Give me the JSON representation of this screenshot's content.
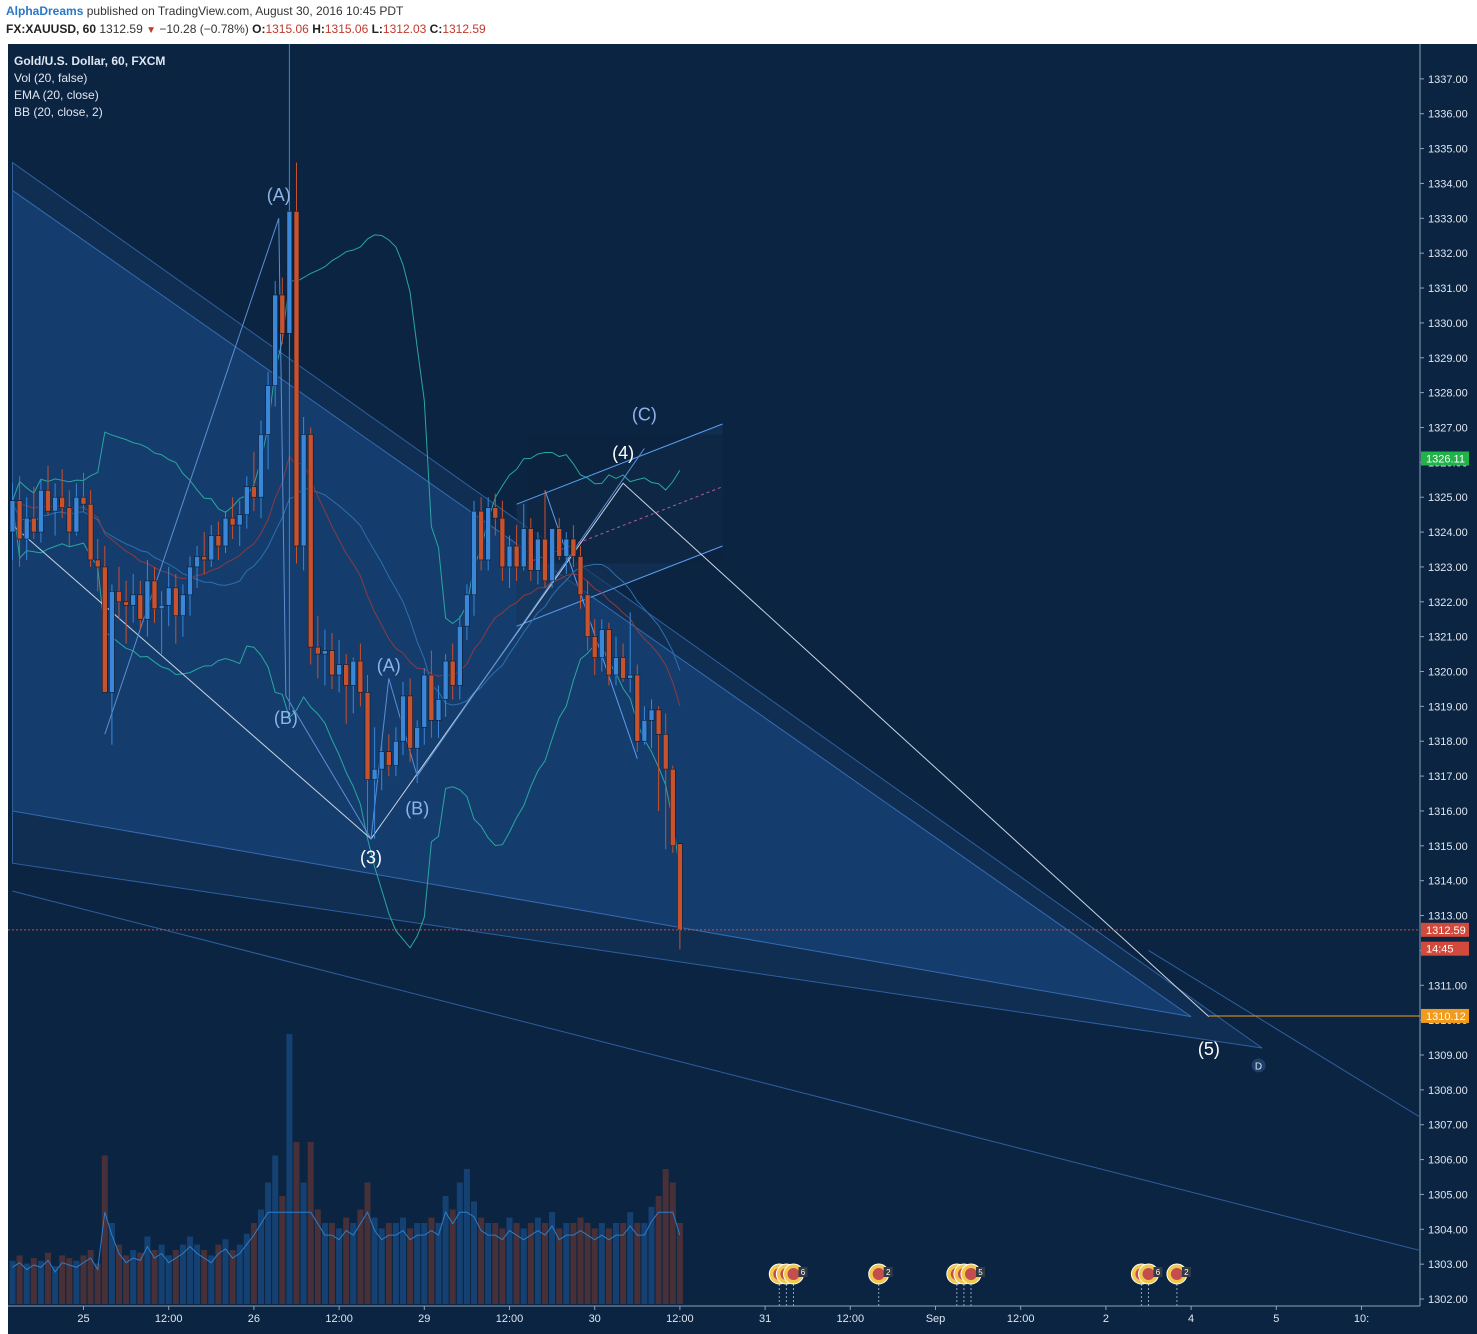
{
  "header": {
    "author": "AlphaDreams",
    "published": "published on TradingView.com, August 30, 2016 10:45 PDT",
    "symbol": "FX:XAUUSD, 60",
    "last": "1312.59",
    "change": "−10.28 (−0.78%)",
    "o_label": "O:",
    "o": "1315.06",
    "h_label": "H:",
    "h": "1315.06",
    "l_label": "L:",
    "l": "1312.03",
    "c_label": "C:",
    "c": "1312.59"
  },
  "legend": {
    "title": "Gold/U.S. Dollar, 60, FXCM",
    "vol": "Vol (20, false)",
    "ema": "EMA (20, close)",
    "bb": "BB (20, close, 2)"
  },
  "colors": {
    "background": "#0b2442",
    "up": "#3a86d8",
    "down": "#c8512e",
    "bb": "#2aa6a0",
    "ema": "#8a3a40",
    "price_tag": "#d24a3b",
    "countdown_tag": "#d24a3b",
    "target_tag": "#f09a1e",
    "high_tag": "#22b24a"
  },
  "chart_data": {
    "type": "candlestick",
    "symbol": "FX:XAUUSD",
    "interval": "60",
    "y_range": [
      1301.8,
      1338.0
    ],
    "y_ticks": [
      1302,
      1303,
      1304,
      1305,
      1306,
      1307,
      1308,
      1309,
      1310,
      1311,
      1312,
      1313,
      1314,
      1315,
      1316,
      1317,
      1318,
      1319,
      1320,
      1321,
      1322,
      1323,
      1324,
      1325,
      1326,
      1327,
      1328,
      1329,
      1330,
      1331,
      1332,
      1333,
      1334,
      1335,
      1336,
      1337
    ],
    "x_labels": [
      {
        "label": "25",
        "bar": 10
      },
      {
        "label": "12:00",
        "bar": 22
      },
      {
        "label": "26",
        "bar": 34
      },
      {
        "label": "12:00",
        "bar": 46
      },
      {
        "label": "29",
        "bar": 58
      },
      {
        "label": "12:00",
        "bar": 70
      },
      {
        "label": "30",
        "bar": 82
      },
      {
        "label": "12:00",
        "bar": 94
      },
      {
        "label": "31",
        "bar": 106
      },
      {
        "label": "12:00",
        "bar": 118
      },
      {
        "label": "Sep",
        "bar": 130
      },
      {
        "label": "12:00",
        "bar": 142
      },
      {
        "label": "2",
        "bar": 154
      },
      {
        "label": "4",
        "bar": 166
      },
      {
        "label": "5",
        "bar": 178
      },
      {
        "label": "10:",
        "bar": 190
      }
    ],
    "candles": [
      {
        "o": 1324.0,
        "h": 1325.4,
        "l": 1323.2,
        "c": 1324.9
      },
      {
        "o": 1324.9,
        "h": 1325.6,
        "l": 1323.0,
        "c": 1323.8
      },
      {
        "o": 1323.8,
        "h": 1325.0,
        "l": 1323.2,
        "c": 1324.4
      },
      {
        "o": 1324.4,
        "h": 1325.3,
        "l": 1323.8,
        "c": 1324.0
      },
      {
        "o": 1324.0,
        "h": 1325.5,
        "l": 1323.7,
        "c": 1325.2
      },
      {
        "o": 1325.2,
        "h": 1325.9,
        "l": 1324.5,
        "c": 1324.6
      },
      {
        "o": 1324.6,
        "h": 1325.4,
        "l": 1323.9,
        "c": 1325.0
      },
      {
        "o": 1325.0,
        "h": 1325.8,
        "l": 1324.4,
        "c": 1324.7
      },
      {
        "o": 1324.7,
        "h": 1325.2,
        "l": 1323.6,
        "c": 1324.0
      },
      {
        "o": 1324.0,
        "h": 1325.4,
        "l": 1323.9,
        "c": 1325.0
      },
      {
        "o": 1325.0,
        "h": 1325.7,
        "l": 1324.6,
        "c": 1324.8
      },
      {
        "o": 1324.8,
        "h": 1325.2,
        "l": 1323.0,
        "c": 1323.2
      },
      {
        "o": 1323.2,
        "h": 1323.8,
        "l": 1322.3,
        "c": 1323.0
      },
      {
        "o": 1323.0,
        "h": 1323.6,
        "l": 1319.4,
        "c": 1319.4
      },
      {
        "o": 1319.4,
        "h": 1322.5,
        "l": 1317.9,
        "c": 1322.3
      },
      {
        "o": 1322.3,
        "h": 1323.0,
        "l": 1321.5,
        "c": 1322.0
      },
      {
        "o": 1322.0,
        "h": 1322.6,
        "l": 1320.8,
        "c": 1321.9
      },
      {
        "o": 1321.9,
        "h": 1322.8,
        "l": 1321.4,
        "c": 1322.2
      },
      {
        "o": 1322.2,
        "h": 1322.6,
        "l": 1321.2,
        "c": 1321.5
      },
      {
        "o": 1321.5,
        "h": 1323.2,
        "l": 1321.0,
        "c": 1322.6
      },
      {
        "o": 1322.6,
        "h": 1323.0,
        "l": 1321.4,
        "c": 1321.8
      },
      {
        "o": 1321.8,
        "h": 1322.3,
        "l": 1320.5,
        "c": 1321.9
      },
      {
        "o": 1321.9,
        "h": 1323.0,
        "l": 1321.3,
        "c": 1322.4
      },
      {
        "o": 1322.4,
        "h": 1322.8,
        "l": 1320.8,
        "c": 1321.6
      },
      {
        "o": 1321.6,
        "h": 1322.5,
        "l": 1321.0,
        "c": 1322.2
      },
      {
        "o": 1322.2,
        "h": 1323.3,
        "l": 1321.6,
        "c": 1323.0
      },
      {
        "o": 1323.0,
        "h": 1323.6,
        "l": 1322.4,
        "c": 1323.3
      },
      {
        "o": 1323.3,
        "h": 1324.0,
        "l": 1322.8,
        "c": 1323.2
      },
      {
        "o": 1323.2,
        "h": 1324.2,
        "l": 1323.0,
        "c": 1323.9
      },
      {
        "o": 1323.9,
        "h": 1324.3,
        "l": 1323.2,
        "c": 1323.6
      },
      {
        "o": 1323.6,
        "h": 1324.6,
        "l": 1323.4,
        "c": 1324.4
      },
      {
        "o": 1324.4,
        "h": 1325.0,
        "l": 1323.8,
        "c": 1324.2
      },
      {
        "o": 1324.2,
        "h": 1324.9,
        "l": 1323.6,
        "c": 1324.5
      },
      {
        "o": 1324.5,
        "h": 1325.6,
        "l": 1324.1,
        "c": 1325.3
      },
      {
        "o": 1325.3,
        "h": 1326.3,
        "l": 1324.6,
        "c": 1325.0
      },
      {
        "o": 1325.0,
        "h": 1327.2,
        "l": 1324.4,
        "c": 1326.8
      },
      {
        "o": 1326.8,
        "h": 1328.6,
        "l": 1325.8,
        "c": 1328.2
      },
      {
        "o": 1328.2,
        "h": 1331.2,
        "l": 1327.6,
        "c": 1330.8
      },
      {
        "o": 1330.8,
        "h": 1331.3,
        "l": 1329.4,
        "c": 1329.7
      },
      {
        "o": 1329.7,
        "h": 1340.5,
        "l": 1318.9,
        "c": 1333.2
      },
      {
        "o": 1333.2,
        "h": 1334.6,
        "l": 1323.1,
        "c": 1323.6
      },
      {
        "o": 1323.6,
        "h": 1327.3,
        "l": 1322.9,
        "c": 1326.8
      },
      {
        "o": 1326.8,
        "h": 1327.0,
        "l": 1320.2,
        "c": 1320.7
      },
      {
        "o": 1320.7,
        "h": 1321.6,
        "l": 1319.8,
        "c": 1320.5
      },
      {
        "o": 1320.5,
        "h": 1321.2,
        "l": 1319.6,
        "c": 1320.6
      },
      {
        "o": 1320.6,
        "h": 1321.1,
        "l": 1319.5,
        "c": 1319.9
      },
      {
        "o": 1319.9,
        "h": 1320.9,
        "l": 1319.4,
        "c": 1320.2
      },
      {
        "o": 1320.2,
        "h": 1320.5,
        "l": 1318.5,
        "c": 1319.6
      },
      {
        "o": 1319.6,
        "h": 1320.4,
        "l": 1318.8,
        "c": 1320.3
      },
      {
        "o": 1320.3,
        "h": 1320.8,
        "l": 1319.0,
        "c": 1319.4
      },
      {
        "o": 1319.4,
        "h": 1319.9,
        "l": 1315.3,
        "c": 1316.9
      },
      {
        "o": 1316.9,
        "h": 1318.4,
        "l": 1315.2,
        "c": 1317.2
      },
      {
        "o": 1317.2,
        "h": 1318.0,
        "l": 1316.6,
        "c": 1317.7
      },
      {
        "o": 1317.7,
        "h": 1318.2,
        "l": 1317.0,
        "c": 1317.3
      },
      {
        "o": 1317.3,
        "h": 1318.4,
        "l": 1317.0,
        "c": 1318.0
      },
      {
        "o": 1318.0,
        "h": 1319.7,
        "l": 1317.6,
        "c": 1319.3
      },
      {
        "o": 1319.3,
        "h": 1319.8,
        "l": 1317.4,
        "c": 1317.8
      },
      {
        "o": 1317.8,
        "h": 1318.6,
        "l": 1316.8,
        "c": 1318.4
      },
      {
        "o": 1318.4,
        "h": 1320.1,
        "l": 1317.9,
        "c": 1319.9
      },
      {
        "o": 1319.9,
        "h": 1320.6,
        "l": 1318.1,
        "c": 1318.6
      },
      {
        "o": 1318.6,
        "h": 1319.6,
        "l": 1318.1,
        "c": 1319.2
      },
      {
        "o": 1319.2,
        "h": 1320.5,
        "l": 1318.7,
        "c": 1320.3
      },
      {
        "o": 1320.3,
        "h": 1320.8,
        "l": 1319.2,
        "c": 1319.6
      },
      {
        "o": 1319.6,
        "h": 1321.6,
        "l": 1319.2,
        "c": 1321.3
      },
      {
        "o": 1321.3,
        "h": 1322.5,
        "l": 1320.9,
        "c": 1322.2
      },
      {
        "o": 1322.2,
        "h": 1324.9,
        "l": 1321.6,
        "c": 1324.6
      },
      {
        "o": 1324.6,
        "h": 1325.0,
        "l": 1322.9,
        "c": 1323.2
      },
      {
        "o": 1323.2,
        "h": 1325.0,
        "l": 1322.9,
        "c": 1324.7
      },
      {
        "o": 1324.7,
        "h": 1325.1,
        "l": 1323.9,
        "c": 1324.4
      },
      {
        "o": 1324.4,
        "h": 1324.9,
        "l": 1322.6,
        "c": 1323.0
      },
      {
        "o": 1323.0,
        "h": 1323.9,
        "l": 1322.4,
        "c": 1323.6
      },
      {
        "o": 1323.6,
        "h": 1324.2,
        "l": 1322.6,
        "c": 1323.0
      },
      {
        "o": 1323.0,
        "h": 1324.8,
        "l": 1322.9,
        "c": 1324.1
      },
      {
        "o": 1324.1,
        "h": 1324.4,
        "l": 1322.6,
        "c": 1322.9
      },
      {
        "o": 1322.9,
        "h": 1324.0,
        "l": 1322.5,
        "c": 1323.8
      },
      {
        "o": 1323.8,
        "h": 1325.2,
        "l": 1322.4,
        "c": 1322.6
      },
      {
        "o": 1322.6,
        "h": 1324.1,
        "l": 1322.4,
        "c": 1324.1
      },
      {
        "o": 1324.1,
        "h": 1324.4,
        "l": 1323.2,
        "c": 1323.3
      },
      {
        "o": 1323.3,
        "h": 1324.0,
        "l": 1322.8,
        "c": 1323.8
      },
      {
        "o": 1323.8,
        "h": 1324.2,
        "l": 1323.0,
        "c": 1323.3
      },
      {
        "o": 1323.3,
        "h": 1323.6,
        "l": 1321.8,
        "c": 1322.2
      },
      {
        "o": 1322.2,
        "h": 1322.6,
        "l": 1320.6,
        "c": 1321.0
      },
      {
        "o": 1321.0,
        "h": 1321.5,
        "l": 1319.9,
        "c": 1320.4
      },
      {
        "o": 1320.4,
        "h": 1321.5,
        "l": 1320.0,
        "c": 1321.2
      },
      {
        "o": 1321.2,
        "h": 1321.4,
        "l": 1319.6,
        "c": 1319.9
      },
      {
        "o": 1319.9,
        "h": 1321.0,
        "l": 1319.6,
        "c": 1320.4
      },
      {
        "o": 1320.4,
        "h": 1320.8,
        "l": 1319.7,
        "c": 1319.8
      },
      {
        "o": 1319.8,
        "h": 1321.7,
        "l": 1319.4,
        "c": 1319.9
      },
      {
        "o": 1319.9,
        "h": 1320.2,
        "l": 1317.7,
        "c": 1318.0
      },
      {
        "o": 1318.0,
        "h": 1319.0,
        "l": 1317.9,
        "c": 1318.6
      },
      {
        "o": 1318.6,
        "h": 1319.2,
        "l": 1317.8,
        "c": 1318.9
      },
      {
        "o": 1318.9,
        "h": 1319.0,
        "l": 1316.0,
        "c": 1318.2
      },
      {
        "o": 1318.2,
        "h": 1318.8,
        "l": 1314.9,
        "c": 1317.2
      },
      {
        "o": 1317.2,
        "h": 1317.3,
        "l": 1314.8,
        "c": 1315.0
      },
      {
        "o": 1315.06,
        "h": 1315.06,
        "l": 1312.03,
        "c": 1312.59
      }
    ],
    "volume": [
      0.16,
      0.18,
      0.15,
      0.17,
      0.16,
      0.19,
      0.14,
      0.18,
      0.17,
      0.16,
      0.18,
      0.2,
      0.15,
      0.55,
      0.3,
      0.22,
      0.18,
      0.2,
      0.19,
      0.25,
      0.2,
      0.22,
      0.18,
      0.2,
      0.22,
      0.25,
      0.22,
      0.2,
      0.18,
      0.22,
      0.24,
      0.2,
      0.22,
      0.26,
      0.3,
      0.35,
      0.45,
      0.55,
      0.4,
      1.0,
      0.6,
      0.45,
      0.6,
      0.35,
      0.3,
      0.3,
      0.28,
      0.32,
      0.3,
      0.35,
      0.45,
      0.32,
      0.28,
      0.3,
      0.3,
      0.32,
      0.28,
      0.3,
      0.3,
      0.32,
      0.3,
      0.4,
      0.35,
      0.45,
      0.5,
      0.38,
      0.32,
      0.3,
      0.3,
      0.28,
      0.32,
      0.3,
      0.28,
      0.3,
      0.32,
      0.3,
      0.34,
      0.28,
      0.3,
      0.3,
      0.32,
      0.3,
      0.28,
      0.3,
      0.28,
      0.3,
      0.3,
      0.34,
      0.3,
      0.3,
      0.36,
      0.4,
      0.5,
      0.45,
      0.3
    ],
    "price_tags": [
      {
        "label": "1326.11",
        "value": 1326.11,
        "color": "#22b24a"
      },
      {
        "label": "1312.59",
        "value": 1312.59,
        "color": "#d24a3b"
      },
      {
        "label": "14:45",
        "value": 1312.05,
        "color": "#d24a3b"
      },
      {
        "label": "1310.12",
        "value": 1310.12,
        "color": "#f09a1e"
      }
    ],
    "wave_labels": [
      {
        "text": "(A)",
        "bar": 37.5,
        "price": 1333.5,
        "color": "#8fb4e8"
      },
      {
        "text": "(B)",
        "bar": 38.5,
        "price": 1318.5,
        "color": "#8fb4e8"
      },
      {
        "text": "(3)",
        "bar": 50.5,
        "price": 1314.5,
        "color": "#ffffff"
      },
      {
        "text": "(A)",
        "bar": 53,
        "price": 1320.0,
        "color": "#8fb4e8"
      },
      {
        "text": "(B)",
        "bar": 57,
        "price": 1315.9,
        "color": "#8fb4e8"
      },
      {
        "text": "(4)",
        "bar": 86,
        "price": 1326.1,
        "color": "#ffffff"
      },
      {
        "text": "(C)",
        "bar": 89,
        "price": 1327.2,
        "color": "#8fb4e8"
      },
      {
        "text": "(5)",
        "bar": 168.5,
        "price": 1309.0,
        "color": "#ffffff"
      }
    ],
    "pattern_point": {
      "text": "D",
      "bar": 175.5,
      "price": 1308.7
    },
    "event_markers": [
      {
        "bar": 108,
        "badge": "2"
      },
      {
        "bar": 109,
        "badge": "2"
      },
      {
        "bar": 110,
        "badge": "6"
      },
      {
        "bar": 122,
        "badge": "2"
      },
      {
        "bar": 133,
        "badge": "2"
      },
      {
        "bar": 134,
        "badge": "4"
      },
      {
        "bar": 135,
        "badge": "5"
      },
      {
        "bar": 159,
        "badge": "12"
      },
      {
        "bar": 160,
        "badge": "6"
      },
      {
        "bar": 164,
        "badge": "2"
      }
    ]
  }
}
